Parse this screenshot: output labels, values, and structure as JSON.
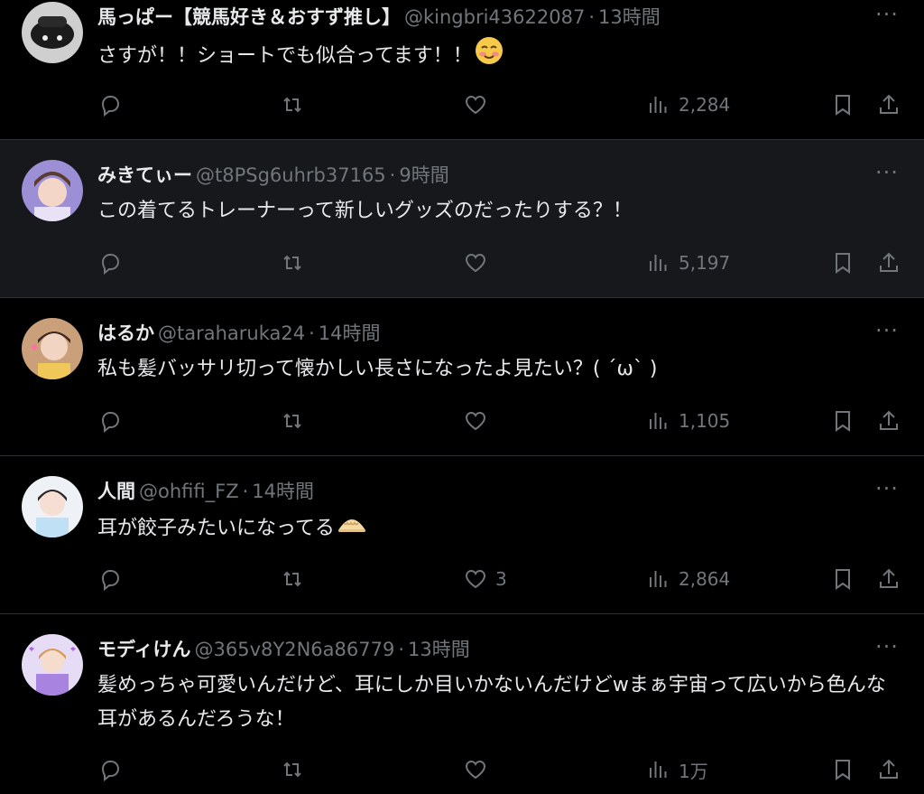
{
  "posts": [
    {
      "name": "馬っぱー【競馬好き＆おすず推し】",
      "handle": "@kingbri43622087",
      "time": "13時間",
      "text": "さすが！！ショートでも似合ってます！！",
      "emoji": "smiling-face-emoji",
      "likes": "",
      "views": "2,284"
    },
    {
      "name": "みきてぃー",
      "handle": "@t8PSg6uhrb37165",
      "time": "9時間",
      "text": "この着てるトレーナーって新しいグッズのだったりする？！",
      "emoji": "",
      "likes": "",
      "views": "5,197"
    },
    {
      "name": "はるか",
      "handle": "@taraharuka24",
      "time": "14時間",
      "text": "私も髪バッサリ切って懐かしい長さになったよ見たい？(  ˊωˋ )",
      "emoji": "",
      "likes": "",
      "views": "1,105"
    },
    {
      "name": "人間",
      "handle": "@ohfifi_FZ",
      "time": "14時間",
      "text": "耳が餃子みたいになってる",
      "emoji": "dumpling-emoji",
      "likes": "3",
      "views": "2,864"
    },
    {
      "name": "モディけん",
      "handle": "@365v8Y2N6a86779",
      "time": "13時間",
      "text": "髪めっちゃ可愛いんだけど、耳にしか目いかないんだけどwまぁ宇宙って広いから色んな耳があるんだろうな！",
      "emoji": "",
      "likes": "",
      "views": "1万"
    }
  ],
  "separator": "·",
  "more_glyph": "···"
}
